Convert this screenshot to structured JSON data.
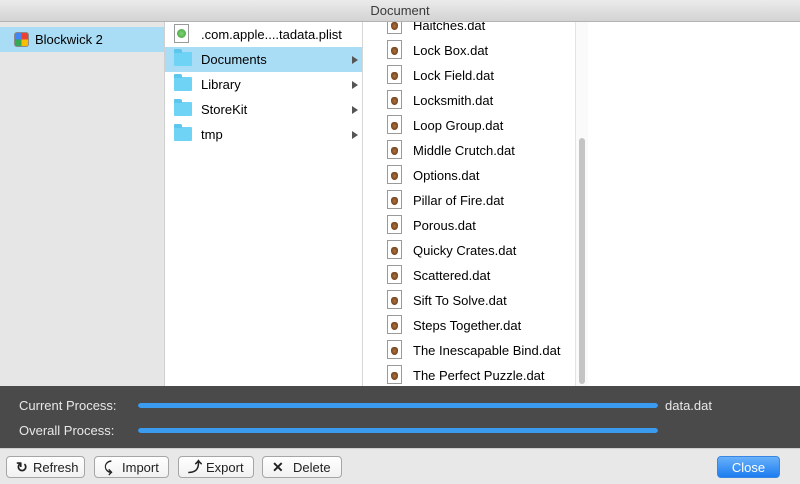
{
  "window": {
    "title": "Document"
  },
  "column1": {
    "items": [
      {
        "label": "Blockwick 2",
        "icon": "app-icon",
        "selected": true
      }
    ]
  },
  "column2": {
    "items": [
      {
        "label": ".com.apple....tadata.plist",
        "icon": "plist-file-icon",
        "type": "file"
      },
      {
        "label": "Documents",
        "icon": "folder-icon",
        "type": "folder",
        "selected": true
      },
      {
        "label": "Library",
        "icon": "folder-icon",
        "type": "folder"
      },
      {
        "label": "StoreKit",
        "icon": "folder-icon",
        "type": "folder"
      },
      {
        "label": "tmp",
        "icon": "folder-icon",
        "type": "folder"
      }
    ]
  },
  "column3": {
    "items": [
      "Haitches.dat",
      "Lock Box.dat",
      "Lock Field.dat",
      "Locksmith.dat",
      "Loop Group.dat",
      "Middle Crutch.dat",
      "Options.dat",
      "Pillar of Fire.dat",
      "Porous.dat",
      "Quicky Crates.dat",
      "Scattered.dat",
      "Sift To Solve.dat",
      "Steps Together.dat",
      "The Inescapable Bind.dat",
      "The Perfect Puzzle.dat"
    ],
    "icon": "dat-file-icon"
  },
  "progress": {
    "current_label": "Current Process:",
    "current_value": 1.0,
    "current_file": "data.dat",
    "overall_label": "Overall Process:",
    "overall_value": 1.0,
    "bar_color": "#3b9bef"
  },
  "toolbar": {
    "refresh_label": "Refresh",
    "import_label": "Import",
    "export_label": "Export",
    "delete_label": "Delete",
    "close_label": "Close"
  },
  "colors": {
    "selection": "#a9dcf5",
    "primary_button": "#1c7cf0"
  }
}
